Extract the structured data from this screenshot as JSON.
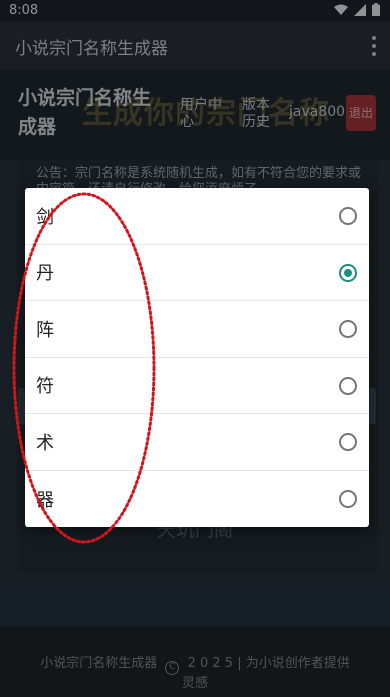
{
  "status_bar": {
    "time": "8:08"
  },
  "app_bar": {
    "title": "小说宗门名称生成器"
  },
  "header": {
    "watermark_title": "生成你的宗门名称",
    "site_name": "小说宗门名称生成器",
    "nav_user_center": "用户中心",
    "nav_history": "版本历史",
    "username": "java800",
    "logout_label": "退出"
  },
  "notice": "公告：宗门名称是系统随机生成，如有不符合您的要求或内容篇，还请自行修改，给您添麻烦了",
  "generate_button": "天玑门阁",
  "footer": {
    "app_name": "小说宗门名称生成器",
    "copyright_symbol": "C",
    "year": "2 0 2 5",
    "tagline": "| 为小说创作者提供",
    "tagline_cont": "灵感"
  },
  "dialog": {
    "options": [
      {
        "label": "剑",
        "selected": false
      },
      {
        "label": "丹",
        "selected": true
      },
      {
        "label": "阵",
        "selected": false
      },
      {
        "label": "符",
        "selected": false
      },
      {
        "label": "术",
        "selected": false
      },
      {
        "label": "器",
        "selected": false
      }
    ]
  },
  "colors": {
    "accent": "#1a8f7a",
    "logout_bg": "#a2343b",
    "annotation": "#d0161c"
  }
}
